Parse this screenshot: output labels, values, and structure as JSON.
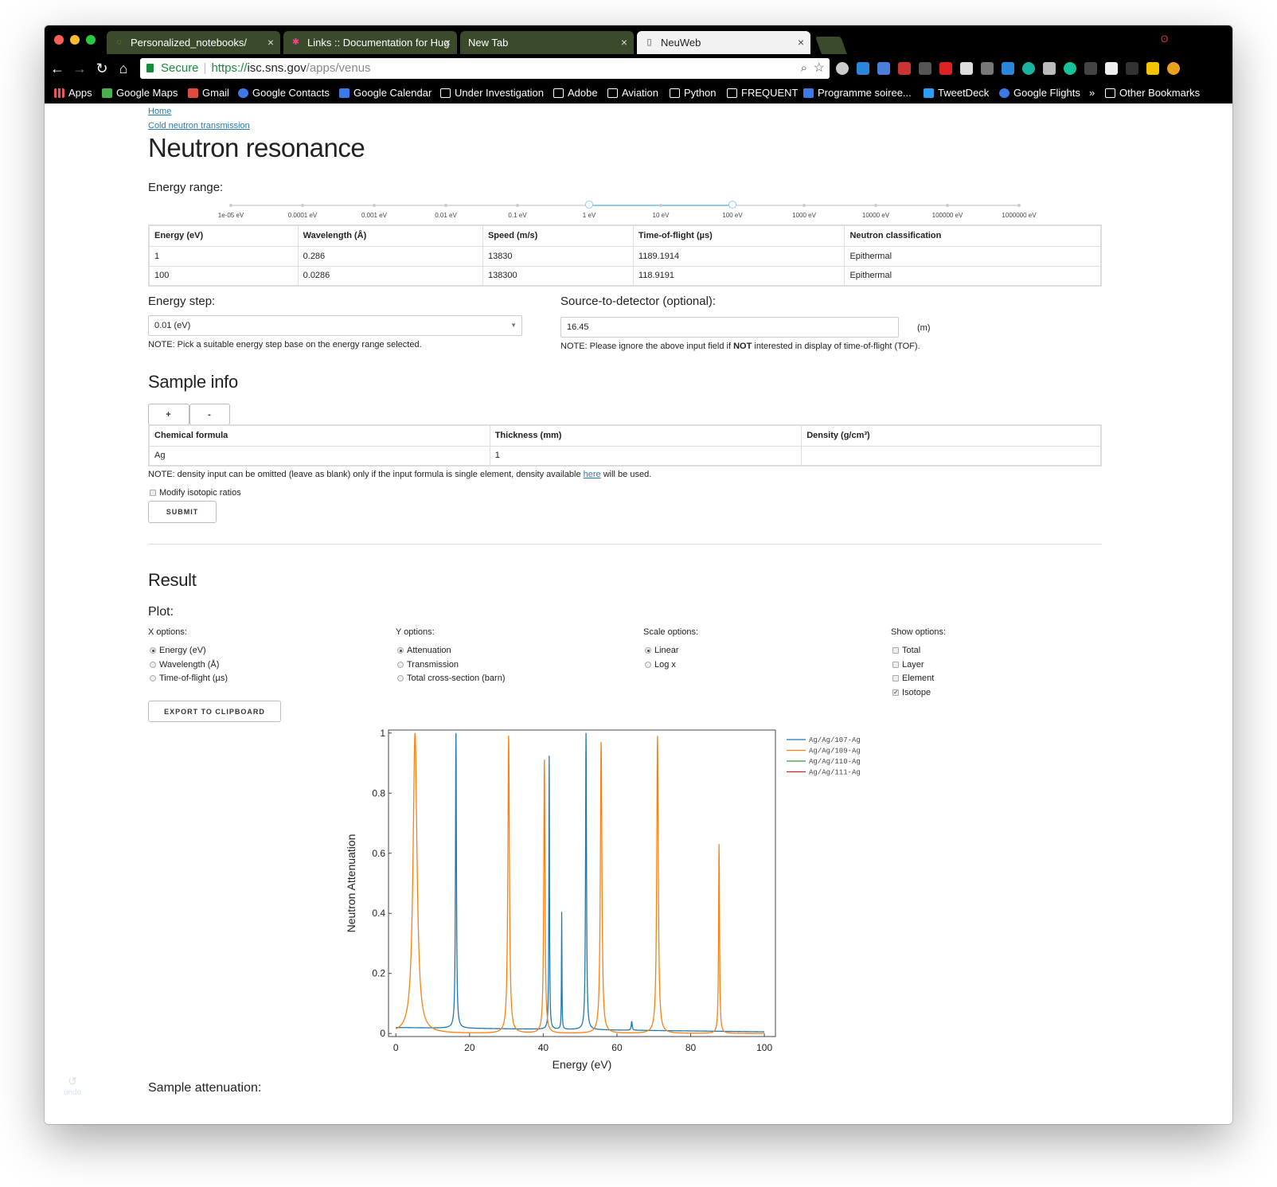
{
  "tabs": [
    {
      "title": "Personalized_notebooks/",
      "icon": "jupyter-icon"
    },
    {
      "title": "Links :: Documentation for Hug",
      "icon": "hugo-icon"
    },
    {
      "title": "New Tab",
      "icon": ""
    },
    {
      "title": "NeuWeb",
      "icon": "page-icon"
    }
  ],
  "address": {
    "secure_label": "Secure",
    "scheme": "https://",
    "host": "isc.sns.gov",
    "path": "/apps/venus"
  },
  "bookmarks": [
    {
      "label": "Apps",
      "icon": "apps-grid-icon"
    },
    {
      "label": "Google Maps",
      "icon": "maps-icon"
    },
    {
      "label": "Gmail",
      "icon": "gmail-icon"
    },
    {
      "label": "Google Contacts",
      "icon": "contacts-icon"
    },
    {
      "label": "Google Calendar",
      "icon": "calendar-icon"
    },
    {
      "label": "Under Investigation",
      "icon": "folder-icon"
    },
    {
      "label": "Adobe",
      "icon": "folder-icon"
    },
    {
      "label": "Aviation",
      "icon": "folder-icon"
    },
    {
      "label": "Python",
      "icon": "folder-icon"
    },
    {
      "label": "FREQUENT",
      "icon": "folder-icon"
    },
    {
      "label": "Programme soiree...",
      "icon": "doc-icon"
    },
    {
      "label": "TweetDeck",
      "icon": "tweetdeck-icon"
    },
    {
      "label": "Google Flights",
      "icon": "flights-icon"
    },
    {
      "label": "»",
      "icon": ""
    },
    {
      "label": "Other Bookmarks",
      "icon": "folder-icon"
    }
  ],
  "breadcrumb": {
    "home": "Home",
    "parent": "Cold neutron transmission"
  },
  "title": "Neutron resonance",
  "energy_range": {
    "label": "Energy range:",
    "ticks": [
      "1e-05 eV",
      "0.0001 eV",
      "0.001 eV",
      "0.01 eV",
      "0.1 eV",
      "1 eV",
      "10 eV",
      "100 eV",
      "1000 eV",
      "10000 eV",
      "100000 eV",
      "1000000 eV"
    ],
    "selected_low": "1 eV",
    "selected_high": "100 eV"
  },
  "range_table": {
    "headers": [
      "Energy (eV)",
      "Wavelength (Å)",
      "Speed (m/s)",
      "Time-of-flight (µs)",
      "Neutron classification"
    ],
    "rows": [
      [
        "1",
        "0.286",
        "13830",
        "1189.1914",
        "Epithermal"
      ],
      [
        "100",
        "0.0286",
        "138300",
        "118.9191",
        "Epithermal"
      ]
    ]
  },
  "energy_step": {
    "label": "Energy step:",
    "value": "0.01 (eV)",
    "note": "NOTE: Pick a suitable energy step base on the energy range selected."
  },
  "source_detector": {
    "label": "Source-to-detector (optional):",
    "value": "16.45",
    "unit": "(m)",
    "note_pre": "NOTE: Please ignore the above input field if ",
    "note_bold": "NOT",
    "note_post": " interested in display of time-of-flight (TOF)."
  },
  "sample_info": {
    "heading": "Sample info",
    "add_label": "+",
    "remove_label": "-",
    "headers": [
      "Chemical formula",
      "Thickness (mm)",
      "Density (g/cm³)"
    ],
    "rows": [
      [
        "Ag",
        "1",
        ""
      ]
    ],
    "note_pre": "NOTE: density input can be omitted (leave as blank) only if the input formula is single element, density available ",
    "note_link": "here",
    "note_post": " will be used.",
    "isotopic_label": "Modify isotopic ratios",
    "submit_label": "SUBMIT"
  },
  "result": {
    "heading": "Result",
    "plot_label": "Plot:",
    "x_options": {
      "label": "X options:",
      "items": [
        "Energy (eV)",
        "Wavelength (Å)",
        "Time-of-flight (µs)"
      ],
      "selected": 0
    },
    "y_options": {
      "label": "Y options:",
      "items": [
        "Attenuation",
        "Transmission",
        "Total cross-section (barn)"
      ],
      "selected": 0
    },
    "scale_options": {
      "label": "Scale options:",
      "items": [
        "Linear",
        "Log x"
      ],
      "selected": 0
    },
    "show_options": {
      "label": "Show options:",
      "items": [
        "Total",
        "Layer",
        "Element",
        "Isotope"
      ],
      "checked": [
        false,
        false,
        false,
        true
      ]
    },
    "export_label": "EXPORT TO CLIPBOARD",
    "sample_attenuation_label": "Sample attenuation:"
  },
  "undo_label": "undo",
  "colors": {
    "blue": "#1f77b4",
    "orange": "#ff7f0e",
    "green": "#2ca02c",
    "red": "#d62728",
    "link": "#2a7ab0",
    "slider": "#8ecdf0"
  },
  "chart_data": {
    "type": "line",
    "xlabel": "Energy (eV)",
    "ylabel": "Neutron Attenuation",
    "xlim": [
      -2,
      103
    ],
    "ylim": [
      0,
      1
    ],
    "xticks": [
      "0",
      "20",
      "40",
      "60",
      "80",
      "100"
    ],
    "yticks": [
      "0",
      "0.2",
      "0.4",
      "0.6",
      "0.8",
      "1"
    ],
    "series": [
      {
        "name": "Ag/Ag/107-Ag",
        "color": "#1f77b4",
        "baseline": 0.02,
        "peaks": [
          [
            16.3,
            1.0,
            0.3
          ],
          [
            41.6,
            0.91,
            0.2
          ],
          [
            45.0,
            0.39,
            0.15
          ],
          [
            51.6,
            1.0,
            0.3
          ],
          [
            64.0,
            0.03,
            0.3
          ]
        ]
      },
      {
        "name": "Ag/Ag/109-Ag",
        "color": "#ff7f0e",
        "baseline": 0.0,
        "peaks": [
          [
            5.2,
            1.0,
            1.3
          ],
          [
            30.6,
            0.99,
            0.5
          ],
          [
            40.3,
            0.91,
            0.4
          ],
          [
            55.7,
            0.97,
            0.5
          ],
          [
            71.0,
            0.99,
            0.5
          ],
          [
            87.7,
            0.63,
            0.3
          ]
        ]
      },
      {
        "name": "Ag/Ag/110-Ag",
        "color": "#2ca02c",
        "baseline": 0.0,
        "peaks": []
      },
      {
        "name": "Ag/Ag/111-Ag",
        "color": "#d62728",
        "baseline": 0.0,
        "peaks": []
      }
    ]
  }
}
